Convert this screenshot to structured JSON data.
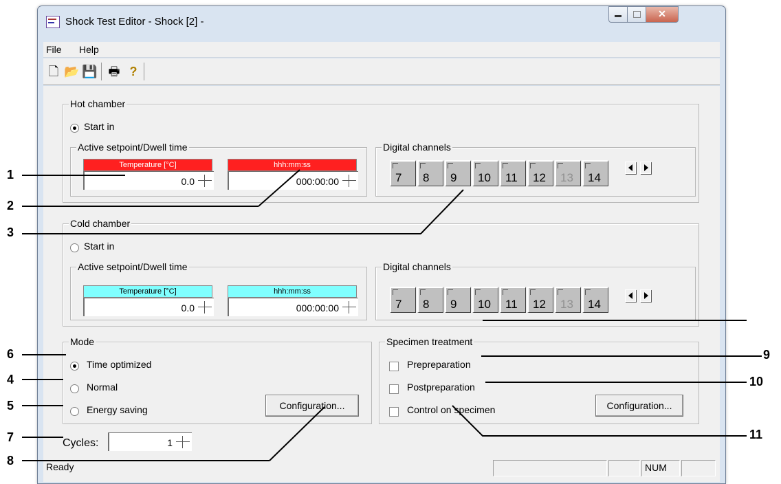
{
  "window": {
    "title": "Shock Test Editor - Shock [2] -",
    "caption_buttons": [
      "minimize-icon",
      "maximize-icon",
      "close-icon"
    ]
  },
  "menu": {
    "items": [
      "File",
      "Help"
    ]
  },
  "toolbar": {
    "icons": [
      "new-file-icon",
      "open-folder-icon",
      "save-icon",
      "print-icon",
      "help-icon"
    ]
  },
  "hot_chamber": {
    "title": "Hot chamber",
    "start_in_label": "Start in",
    "start_in_selected": true,
    "setpoint_group_title": "Active setpoint/Dwell time",
    "temp_header": "Temperature [°C]",
    "temp_value": "0.0",
    "time_header": "hhh:mm:ss",
    "time_value": "000:00:00",
    "header_color": "#ff2020",
    "digital_title": "Digital channels",
    "channels": [
      "7",
      "8",
      "9",
      "10",
      "11",
      "12",
      "13",
      "14"
    ]
  },
  "cold_chamber": {
    "title": "Cold chamber",
    "start_in_label": "Start in",
    "start_in_selected": false,
    "setpoint_group_title": "Active setpoint/Dwell time",
    "temp_header": "Temperature [°C]",
    "temp_value": "0.0",
    "time_header": "hhh:mm:ss",
    "time_value": "000:00:00",
    "header_color": "#80ffff",
    "digital_title": "Digital channels",
    "channels": [
      "7",
      "8",
      "9",
      "10",
      "11",
      "12",
      "13",
      "14"
    ]
  },
  "mode": {
    "title": "Mode",
    "options": [
      "Time optimized",
      "Normal",
      "Energy saving"
    ],
    "selected": "Time optimized",
    "config_button": "Configuration..."
  },
  "cycles": {
    "label": "Cycles:",
    "value": "1"
  },
  "specimen": {
    "title": "Specimen treatment",
    "options": [
      "Prepreparation",
      "Postpreparation",
      "Control on specimen"
    ],
    "config_button": "Configuration..."
  },
  "status_bar": {
    "text": "Ready",
    "num": "NUM"
  },
  "callouts": [
    "1",
    "2",
    "3",
    "4",
    "5",
    "6",
    "7",
    "8",
    "9",
    "10",
    "11"
  ]
}
